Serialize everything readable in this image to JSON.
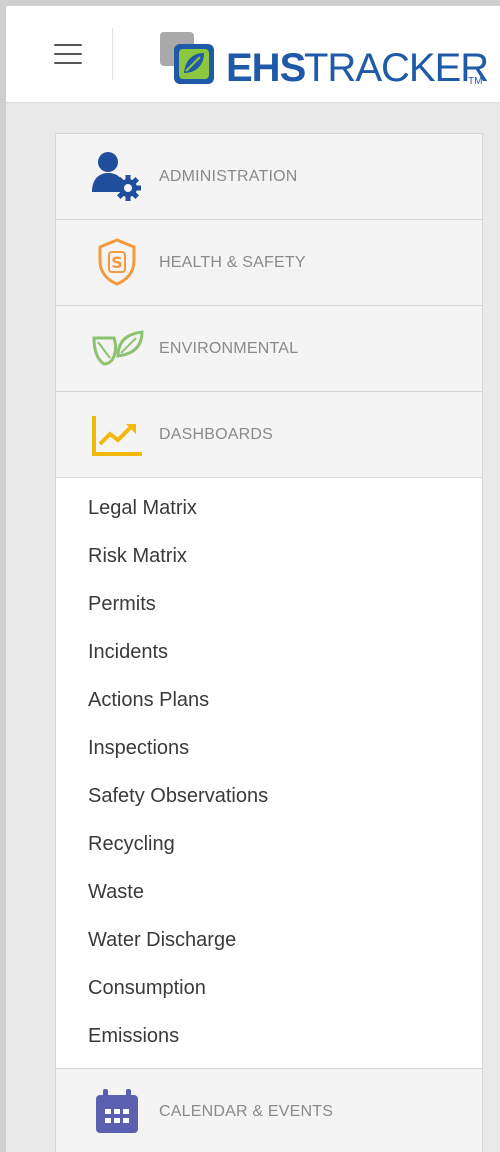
{
  "header": {
    "logo_bold": "EHS",
    "logo_light": "TRACKER",
    "logo_tm": "TM"
  },
  "menu": {
    "sections": [
      {
        "label": "ADMINISTRATION",
        "icon": "admin-user-gear-icon",
        "color": "#1f4e9c"
      },
      {
        "label": "HEALTH & SAFETY",
        "icon": "shield-s-icon",
        "color": "#f39a3e"
      },
      {
        "label": "ENVIRONMENTAL",
        "icon": "leaves-icon",
        "color": "#8dc26f"
      },
      {
        "label": "DASHBOARDS",
        "icon": "trend-chart-icon",
        "color": "#f3b80e"
      }
    ],
    "dashboard_items": [
      "Legal Matrix",
      "Risk Matrix",
      "Permits",
      "Incidents",
      "Actions Plans",
      "Inspections",
      "Safety Observations",
      "Recycling",
      "Waste",
      "Water Discharge",
      "Consumption",
      "Emissions"
    ],
    "calendar_section": {
      "label": "CALENDAR & EVENTS",
      "icon": "calendar-icon",
      "color": "#5b5fb0"
    }
  }
}
